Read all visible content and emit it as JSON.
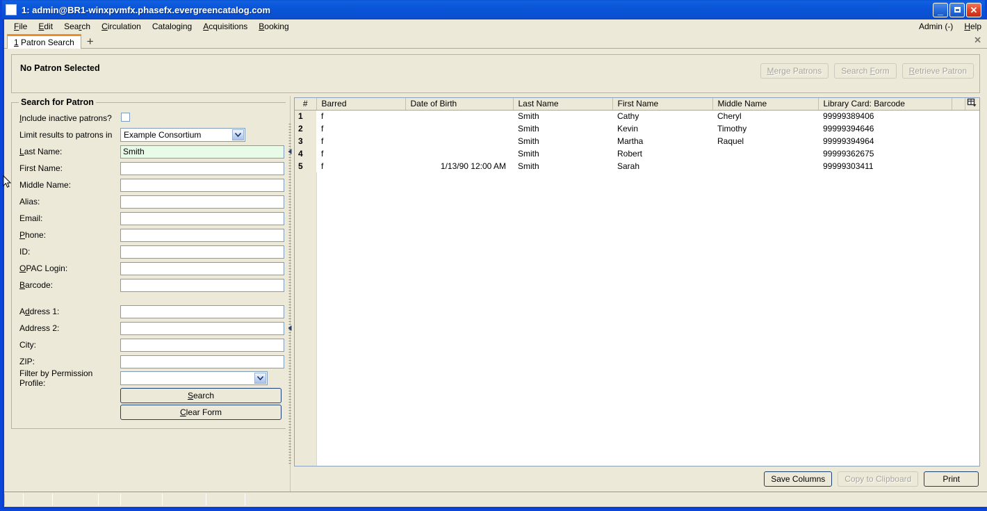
{
  "window": {
    "title": "1: admin@BR1-winxpvmfx.phasefx.evergreencatalog.com",
    "minimize_label": "_",
    "maximize_label": "",
    "close_label": "✕",
    "icon": "app-window-icon"
  },
  "menubar": {
    "items": [
      {
        "label": "File",
        "accel": "F"
      },
      {
        "label": "Edit",
        "accel": "E"
      },
      {
        "label": "Search",
        "accel": "r"
      },
      {
        "label": "Circulation",
        "accel": "C"
      },
      {
        "label": "Cataloging",
        "accel": "g"
      },
      {
        "label": "Acquisitions",
        "accel": "A"
      },
      {
        "label": "Booking",
        "accel": "B"
      }
    ],
    "admin_label": "Admin (-)",
    "help_label": "Help",
    "help_accel": "H"
  },
  "tabbar": {
    "tabs": [
      {
        "index": "1",
        "label": "Patron Search",
        "active": true
      }
    ],
    "add_label": "+",
    "close_label": "✕"
  },
  "patron_header": {
    "title": "No Patron Selected",
    "buttons": [
      {
        "label": "Merge Patrons",
        "accel": "M",
        "enabled": false,
        "name": "merge-patrons-button"
      },
      {
        "label": "Search Form",
        "accel": "F",
        "enabled": false,
        "name": "search-form-button"
      },
      {
        "label": "Retrieve Patron",
        "accel": "R",
        "enabled": false,
        "name": "retrieve-patron-button"
      }
    ]
  },
  "search_form": {
    "legend": "Search for Patron",
    "include_inactive_label": "Include inactive patrons?",
    "include_inactive_accel": "I",
    "include_inactive_checked": false,
    "limit_label": "Limit results to patrons in",
    "limit_value": "Example Consortium",
    "fields": [
      {
        "label": "Last Name:",
        "accel": "L",
        "value": "Smith",
        "focused": true,
        "name": "last-name-field"
      },
      {
        "label": "First Name:",
        "accel": "",
        "value": "",
        "focused": false,
        "name": "first-name-field"
      },
      {
        "label": "Middle Name:",
        "accel": "",
        "value": "",
        "focused": false,
        "name": "middle-name-field"
      },
      {
        "label": "Alias:",
        "accel": "",
        "value": "",
        "focused": false,
        "name": "alias-field"
      },
      {
        "label": "Email:",
        "accel": "",
        "value": "",
        "focused": false,
        "name": "email-field"
      },
      {
        "label": "Phone:",
        "accel": "P",
        "value": "",
        "focused": false,
        "name": "phone-field"
      },
      {
        "label": "ID:",
        "accel": "",
        "value": "",
        "focused": false,
        "name": "id-field"
      },
      {
        "label": "OPAC Login:",
        "accel": "O",
        "value": "",
        "focused": false,
        "name": "opac-login-field"
      },
      {
        "label": "Barcode:",
        "accel": "B",
        "value": "",
        "focused": false,
        "name": "barcode-field"
      }
    ],
    "address_fields": [
      {
        "label": "Address 1:",
        "accel": "d",
        "value": "",
        "name": "address-1-field"
      },
      {
        "label": "Address 2:",
        "accel": "",
        "value": "",
        "name": "address-2-field"
      },
      {
        "label": "City:",
        "accel": "",
        "value": "",
        "name": "city-field"
      },
      {
        "label": "ZIP:",
        "accel": "",
        "value": "",
        "name": "zip-field"
      }
    ],
    "permission_profile_label": "Filter by Permission Profile:",
    "permission_profile_value": "",
    "search_button": "Search",
    "search_accel": "S",
    "clear_button": "Clear Form",
    "clear_accel": "C"
  },
  "results_grid": {
    "columns": [
      "#",
      "Barred",
      "Date of Birth",
      "Last Name",
      "First Name",
      "Middle Name",
      "Library Card: Barcode"
    ],
    "column_picker_icon": "column-picker-icon",
    "rows": [
      {
        "num": "1",
        "barred": "f",
        "dob": "",
        "last": "Smith",
        "first": "Cathy",
        "middle": "Cheryl",
        "barcode": "99999389406"
      },
      {
        "num": "2",
        "barred": "f",
        "dob": "",
        "last": "Smith",
        "first": "Kevin",
        "middle": "Timothy",
        "barcode": "99999394646"
      },
      {
        "num": "3",
        "barred": "f",
        "dob": "",
        "last": "Smith",
        "first": "Martha",
        "middle": "Raquel",
        "barcode": "99999394964"
      },
      {
        "num": "4",
        "barred": "f",
        "dob": "",
        "last": "Smith",
        "first": "Robert",
        "middle": "",
        "barcode": "99999362675"
      },
      {
        "num": "5",
        "barred": "f",
        "dob": "1/13/90 12:00 AM",
        "last": "Smith",
        "first": "Sarah",
        "middle": "",
        "barcode": "99999303411"
      }
    ]
  },
  "footer": {
    "save_columns": "Save Columns",
    "copy_clipboard": "Copy to Clipboard",
    "print": "Print",
    "copy_enabled": false
  },
  "colors": {
    "titlebar_blue": "#0a55d8",
    "window_border": "#0a46d8",
    "chrome": "#ece9d8",
    "tab_accent": "#f08a24",
    "focused_field": "#e8fbe8",
    "button_border": "#1b3f73"
  }
}
